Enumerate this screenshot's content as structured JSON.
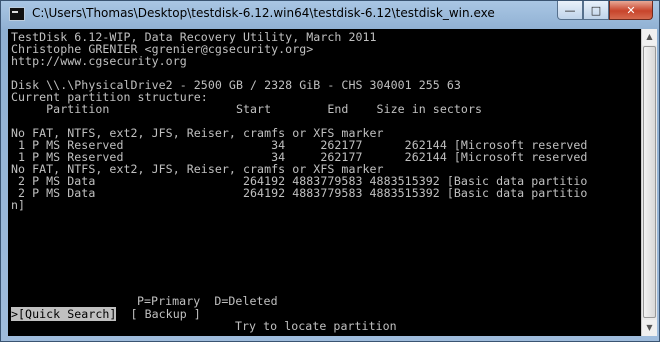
{
  "window": {
    "title": "C:\\Users\\Thomas\\Desktop\\testdisk-6.12.win64\\testdisk-6.12\\testdisk_win.exe",
    "minimize_glyph": "—",
    "maximize_glyph": "□",
    "close_glyph": "✕"
  },
  "console": {
    "header": [
      "TestDisk 6.12-WIP, Data Recovery Utility, March 2011",
      "Christophe GRENIER <grenier@cgsecurity.org>",
      "http://www.cgsecurity.org"
    ],
    "disk_line": "Disk \\\\.\\PhysicalDrive2 - 2500 GB / 2328 GiB - CHS 304001 255 63",
    "structure_title": "Current partition structure:",
    "columns_line": "     Partition                  Start        End    Size in sectors",
    "rows": [
      "No FAT, NTFS, ext2, JFS, Reiser, cramfs or XFS marker",
      " 1 P MS Reserved                     34     262177      262144 [Microsoft reserved",
      " 1 P MS Reserved                     34     262177      262144 [Microsoft reserved",
      "No FAT, NTFS, ext2, JFS, Reiser, cramfs or XFS marker",
      " 2 P MS Data                     264192 4883779583 4883515392 [Basic data partitio",
      " 2 P MS Data                     264192 4883779583 4883515392 [Basic data partitio",
      "n]"
    ],
    "legend": "P=Primary  D=Deleted",
    "menu_cursor": ">",
    "menu_quick_search": "[Quick Search]",
    "menu_backup": "[ Backup ]",
    "hint": "Try to locate partition"
  }
}
